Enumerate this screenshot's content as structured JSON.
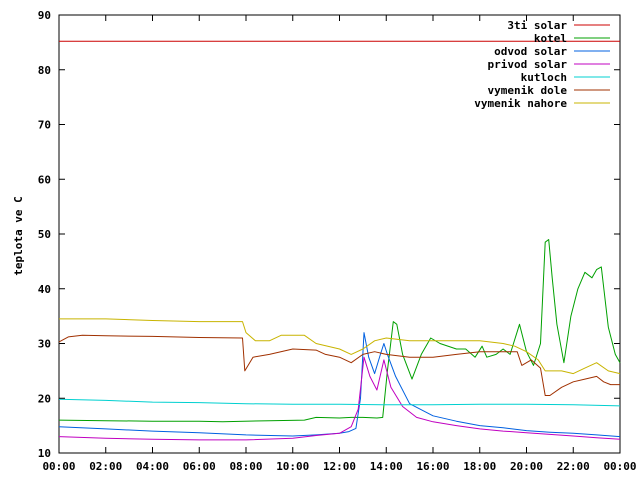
{
  "chart_data": {
    "type": "line",
    "title": "",
    "xlabel": "",
    "ylabel": "teplota ve C",
    "xlim": [
      "00:00",
      "24:00"
    ],
    "ylim": [
      10,
      90
    ],
    "grid": false,
    "legend_position": "top-right",
    "x_ticks": [
      "00:00",
      "02:00",
      "04:00",
      "06:00",
      "08:00",
      "10:00",
      "12:00",
      "14:00",
      "16:00",
      "18:00",
      "20:00",
      "22:00",
      "00:00"
    ],
    "y_ticks": [
      "10",
      "20",
      "30",
      "40",
      "50",
      "60",
      "70",
      "80",
      "90"
    ],
    "series": [
      {
        "name": "3ti solar",
        "color": "#cc0000",
        "points": [
          [
            0,
            85.2
          ],
          [
            24,
            85.2
          ]
        ]
      },
      {
        "name": "kotel",
        "color": "#00a000",
        "points": [
          [
            0,
            16
          ],
          [
            2,
            15.9
          ],
          [
            4,
            15.8
          ],
          [
            6,
            15.8
          ],
          [
            7,
            15.7
          ],
          [
            9,
            15.9
          ],
          [
            10.5,
            16
          ],
          [
            11,
            16.5
          ],
          [
            12,
            16.4
          ],
          [
            12.5,
            16.5
          ],
          [
            13,
            16.5
          ],
          [
            13.6,
            16.4
          ],
          [
            13.85,
            16.5
          ],
          [
            14.05,
            25
          ],
          [
            14.3,
            34
          ],
          [
            14.45,
            33.5
          ],
          [
            14.7,
            28
          ],
          [
            15.1,
            23.5
          ],
          [
            15.5,
            28
          ],
          [
            15.9,
            31
          ],
          [
            16.3,
            30
          ],
          [
            17,
            29
          ],
          [
            17.4,
            29
          ],
          [
            17.8,
            27.5
          ],
          [
            18.1,
            29.5
          ],
          [
            18.3,
            27.5
          ],
          [
            18.7,
            28
          ],
          [
            19,
            29
          ],
          [
            19.3,
            28
          ],
          [
            19.7,
            33.5
          ],
          [
            20,
            28.5
          ],
          [
            20.3,
            26
          ],
          [
            20.6,
            30
          ],
          [
            20.8,
            48.5
          ],
          [
            20.95,
            49
          ],
          [
            21.1,
            42
          ],
          [
            21.3,
            33.5
          ],
          [
            21.6,
            26.5
          ],
          [
            21.9,
            35
          ],
          [
            22.2,
            40
          ],
          [
            22.5,
            43
          ],
          [
            22.8,
            42
          ],
          [
            23.0,
            43.5
          ],
          [
            23.2,
            44
          ],
          [
            23.5,
            33
          ],
          [
            23.8,
            28
          ],
          [
            24,
            26.5
          ]
        ]
      },
      {
        "name": "odvod solar",
        "color": "#0060e0",
        "points": [
          [
            0,
            14.8
          ],
          [
            2,
            14.4
          ],
          [
            4,
            14
          ],
          [
            6,
            13.7
          ],
          [
            8,
            13.3
          ],
          [
            10,
            13.1
          ],
          [
            11,
            13.3
          ],
          [
            12,
            13.6
          ],
          [
            12.4,
            13.9
          ],
          [
            12.7,
            14.5
          ],
          [
            12.9,
            20
          ],
          [
            13.05,
            32
          ],
          [
            13.25,
            27.5
          ],
          [
            13.5,
            24.5
          ],
          [
            13.75,
            28
          ],
          [
            13.9,
            30
          ],
          [
            14.05,
            28
          ],
          [
            14.4,
            24
          ],
          [
            15,
            19
          ],
          [
            16,
            16.8
          ],
          [
            17,
            15.8
          ],
          [
            18,
            15
          ],
          [
            19,
            14.6
          ],
          [
            20,
            14.1
          ],
          [
            21,
            13.8
          ],
          [
            22,
            13.6
          ],
          [
            23,
            13.3
          ],
          [
            24,
            13
          ]
        ]
      },
      {
        "name": "privod solar",
        "color": "#c000c0",
        "points": [
          [
            0,
            13
          ],
          [
            2,
            12.7
          ],
          [
            4,
            12.5
          ],
          [
            6,
            12.4
          ],
          [
            8,
            12.4
          ],
          [
            10,
            12.7
          ],
          [
            11,
            13.2
          ],
          [
            12,
            13.6
          ],
          [
            12.5,
            14.8
          ],
          [
            12.8,
            18
          ],
          [
            13.05,
            27.5
          ],
          [
            13.3,
            24
          ],
          [
            13.6,
            21.5
          ],
          [
            13.9,
            27
          ],
          [
            14.2,
            22
          ],
          [
            14.7,
            18.5
          ],
          [
            15.3,
            16.5
          ],
          [
            16,
            15.7
          ],
          [
            17,
            15
          ],
          [
            18,
            14.4
          ],
          [
            19,
            14
          ],
          [
            20,
            13.7
          ],
          [
            21,
            13.4
          ],
          [
            22,
            13.1
          ],
          [
            23,
            12.8
          ],
          [
            24,
            12.5
          ]
        ]
      },
      {
        "name": "kutloch",
        "color": "#00d0d0",
        "points": [
          [
            0,
            19.8
          ],
          [
            2,
            19.6
          ],
          [
            4,
            19.3
          ],
          [
            6,
            19.2
          ],
          [
            8,
            19
          ],
          [
            10,
            18.9
          ],
          [
            12,
            18.9
          ],
          [
            14,
            18.8
          ],
          [
            16,
            18.8
          ],
          [
            18,
            18.9
          ],
          [
            20,
            18.9
          ],
          [
            22,
            18.8
          ],
          [
            24,
            18.6
          ]
        ]
      },
      {
        "name": "vymenik dole",
        "color": "#a03000",
        "points": [
          [
            0,
            30.3
          ],
          [
            0.4,
            31.2
          ],
          [
            1,
            31.5
          ],
          [
            2,
            31.4
          ],
          [
            4,
            31.3
          ],
          [
            6,
            31.1
          ],
          [
            7.85,
            31
          ],
          [
            7.95,
            25
          ],
          [
            8.3,
            27.5
          ],
          [
            9,
            28
          ],
          [
            10,
            29
          ],
          [
            11,
            28.8
          ],
          [
            11.4,
            28
          ],
          [
            12,
            27.5
          ],
          [
            12.5,
            26.5
          ],
          [
            13,
            28
          ],
          [
            13.5,
            28.5
          ],
          [
            14,
            28
          ],
          [
            15,
            27.5
          ],
          [
            16,
            27.5
          ],
          [
            17,
            28
          ],
          [
            18,
            28.5
          ],
          [
            19,
            28.5
          ],
          [
            19.6,
            28.5
          ],
          [
            19.8,
            26
          ],
          [
            20.2,
            27
          ],
          [
            20.6,
            25.5
          ],
          [
            20.8,
            20.5
          ],
          [
            21,
            20.5
          ],
          [
            21.5,
            22
          ],
          [
            22,
            23
          ],
          [
            22.5,
            23.5
          ],
          [
            23,
            24
          ],
          [
            23.3,
            23
          ],
          [
            23.6,
            22.5
          ],
          [
            24,
            22.5
          ]
        ]
      },
      {
        "name": "vymenik nahore",
        "color": "#c8b400",
        "points": [
          [
            0,
            34.5
          ],
          [
            2,
            34.5
          ],
          [
            4,
            34.2
          ],
          [
            6,
            34
          ],
          [
            7.85,
            34
          ],
          [
            8.0,
            32
          ],
          [
            8.4,
            30.5
          ],
          [
            9,
            30.5
          ],
          [
            9.5,
            31.5
          ],
          [
            10.5,
            31.5
          ],
          [
            11,
            30
          ],
          [
            12,
            29
          ],
          [
            12.5,
            28
          ],
          [
            13,
            29
          ],
          [
            13.5,
            30.5
          ],
          [
            14,
            31
          ],
          [
            15,
            30.5
          ],
          [
            16,
            30.5
          ],
          [
            17,
            30.5
          ],
          [
            18,
            30.5
          ],
          [
            19,
            30
          ],
          [
            19.5,
            29.5
          ],
          [
            20,
            28.5
          ],
          [
            20.5,
            27
          ],
          [
            20.8,
            25
          ],
          [
            21.5,
            25
          ],
          [
            22,
            24.5
          ],
          [
            22.5,
            25.5
          ],
          [
            23,
            26.5
          ],
          [
            23.5,
            25
          ],
          [
            24,
            24.5
          ]
        ]
      }
    ]
  }
}
